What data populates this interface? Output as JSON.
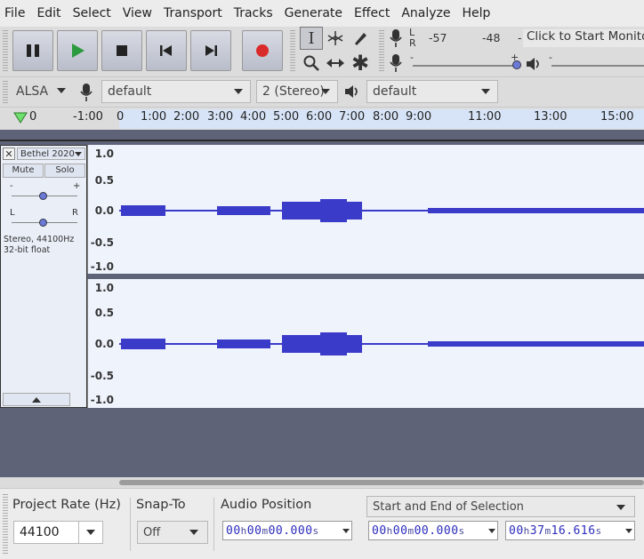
{
  "menu": {
    "items": [
      "File",
      "Edit",
      "Select",
      "View",
      "Transport",
      "Tracks",
      "Generate",
      "Effect",
      "Analyze",
      "Help"
    ]
  },
  "toolbar": {
    "transport": [
      "pause-icon",
      "play-icon",
      "stop-icon",
      "skip-start-icon",
      "skip-end-icon",
      "record-icon"
    ],
    "tools": [
      "selection-tool-icon",
      "envelope-tool-icon",
      "draw-tool-icon",
      "zoom-tool-icon",
      "timeshift-tool-icon",
      "multi-tool-icon"
    ],
    "meter": {
      "rec_L": "L",
      "rec_R": "R",
      "level1": "-57",
      "level2": "-48",
      "monitor_label": "Click to Start Monitoring",
      "minus": "-",
      "plus": "+"
    },
    "colors": {
      "play": "#2c9a3e",
      "record": "#d92b2b"
    }
  },
  "device": {
    "host": "ALSA",
    "recording_device": "default",
    "channels": "2 (Stereo)",
    "playback_device": "default"
  },
  "ruler": {
    "labels": [
      "0",
      "-1:00",
      "0",
      "1:00",
      "2:00",
      "3:00",
      "4:00",
      "5:00",
      "6:00",
      "7:00",
      "8:00",
      "9:00",
      "11:00",
      "13:00",
      "15:00"
    ]
  },
  "track": {
    "name": "Bethel 2020",
    "mute": "Mute",
    "solo": "Solo",
    "gain_minus": "-",
    "gain_plus": "+",
    "pan_L": "L",
    "pan_R": "R",
    "info_rate": "Stereo, 44100Hz",
    "info_format": "32-bit float",
    "scale": [
      "1.0",
      "0.5",
      "0.0",
      "-0.5",
      "-1.0"
    ],
    "wave_color": "#3b3bc9"
  },
  "selection_bar": {
    "project_rate_label": "Project Rate (Hz)",
    "project_rate_value": "44100",
    "snap_label": "Snap-To",
    "snap_value": "Off",
    "audio_position_label": "Audio Position",
    "selection_mode": "Start and End of Selection",
    "audio_position": {
      "h": "00",
      "m": "00",
      "s": "00.000"
    },
    "sel_start": {
      "h": "00",
      "m": "00",
      "s": "00.000"
    },
    "sel_end": {
      "h": "00",
      "m": "37",
      "s": "16.616"
    },
    "unit_h": "h",
    "unit_m": "m",
    "unit_s": "s"
  }
}
